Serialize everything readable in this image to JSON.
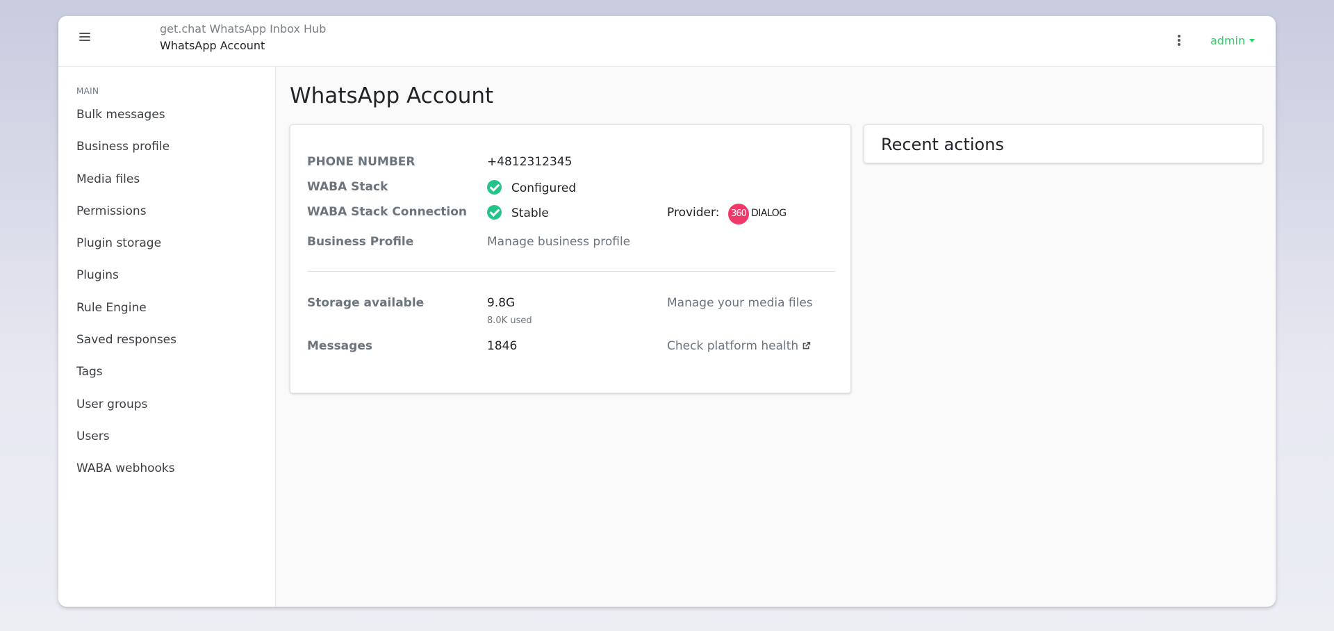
{
  "header": {
    "app_title": "get.chat WhatsApp Inbox Hub",
    "page_name": "WhatsApp Account",
    "user_menu_label": "admin"
  },
  "sidebar": {
    "section_label": "MAIN",
    "items": [
      {
        "label": "Bulk messages"
      },
      {
        "label": "Business profile"
      },
      {
        "label": "Media files"
      },
      {
        "label": "Permissions"
      },
      {
        "label": "Plugin storage"
      },
      {
        "label": "Plugins"
      },
      {
        "label": "Rule Engine"
      },
      {
        "label": "Saved responses"
      },
      {
        "label": "Tags"
      },
      {
        "label": "User groups"
      },
      {
        "label": "Users"
      },
      {
        "label": "WABA webhooks"
      }
    ]
  },
  "main": {
    "title": "WhatsApp Account",
    "account": {
      "phone_label": "PHONE NUMBER",
      "phone_value": "+4812312345",
      "stack_label": "WABA Stack",
      "stack_value": "Configured",
      "connection_label": "WABA Stack Connection",
      "connection_value": "Stable",
      "provider_label": "Provider:",
      "provider_logo_number": "360",
      "provider_logo_text": "DIALOG",
      "business_profile_label": "Business Profile",
      "business_profile_link": "Manage business profile",
      "storage_label": "Storage available",
      "storage_value": "9.8G",
      "storage_used": "8.0K used",
      "media_link": "Manage your media files",
      "messages_label": "Messages",
      "messages_value": "1846",
      "health_link": "Check platform health"
    },
    "recent_actions_title": "Recent actions"
  },
  "colors": {
    "accent": "#25d366",
    "status_ok": "#25c38a",
    "provider_brand": "#f0386b"
  },
  "icons": {
    "menu": "hamburger-menu-icon",
    "more": "kebab-more-icon",
    "status": "check-circle-icon",
    "external": "external-link-icon"
  }
}
